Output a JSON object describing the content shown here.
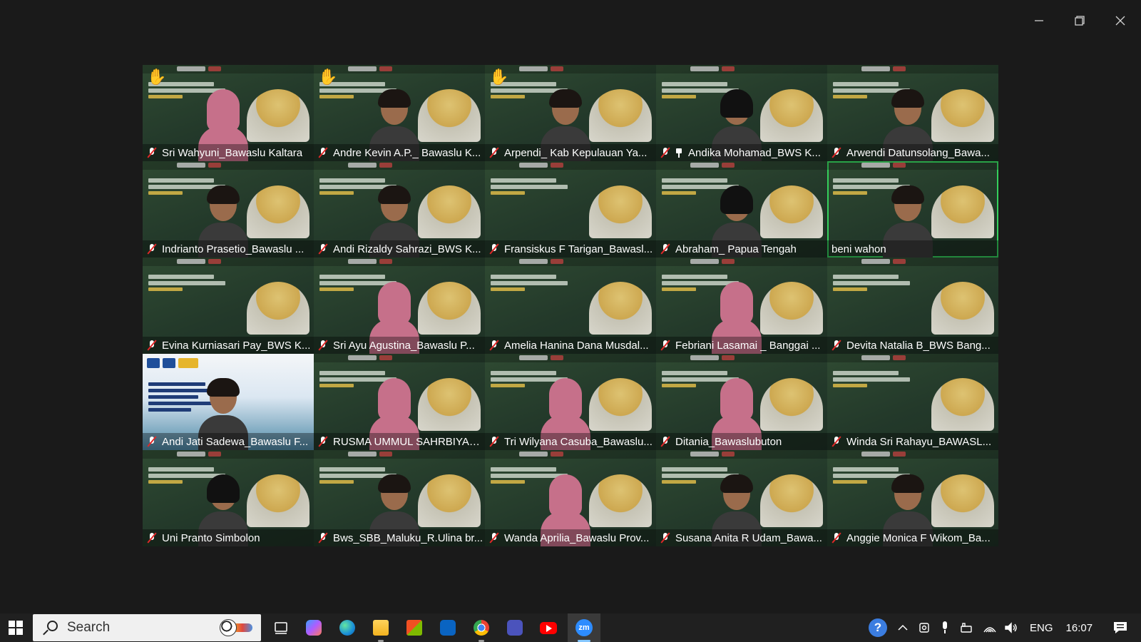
{
  "window": {
    "controls": [
      "minimize",
      "restore",
      "close"
    ]
  },
  "participants": [
    {
      "name": "Sri Wahyuni_Bawaslu Kaltara",
      "muted": true,
      "hand_raised": true
    },
    {
      "name": "Andre Kevin A.P._ Bawaslu K...",
      "muted": true,
      "hand_raised": true
    },
    {
      "name": "Arpendi_ Kab Kepulauan Ya...",
      "muted": true,
      "hand_raised": true
    },
    {
      "name": "Andika Mohamad_BWS K...",
      "muted": true,
      "pinned": true
    },
    {
      "name": "Arwendi Datunsolang_Bawa...",
      "muted": true
    },
    {
      "name": "Indrianto Prasetio_Bawaslu ...",
      "muted": true
    },
    {
      "name": "Andi Rizaldy Sahrazi_BWS K...",
      "muted": true
    },
    {
      "name": "Fransiskus F Tarigan_Bawasl...",
      "muted": true
    },
    {
      "name": "Abraham_ Papua Tengah",
      "muted": true
    },
    {
      "name": "beni wahon",
      "muted": false,
      "active_speaker": true
    },
    {
      "name": "Evina Kurniasari Pay_BWS K...",
      "muted": true
    },
    {
      "name": "Sri Ayu Agustina_Bawaslu P...",
      "muted": true
    },
    {
      "name": "Amelia Hanina Dana Musdal...",
      "muted": true
    },
    {
      "name": "Febriani Lasamai _ Banggai ...",
      "muted": true
    },
    {
      "name": "Devita Natalia B_BWS Bang...",
      "muted": true
    },
    {
      "name": "Andi Jati Sadewa_Bawaslu F...",
      "muted": true,
      "poster_background": true
    },
    {
      "name": "RUSMA UMMUL SAHRBIYAH...",
      "muted": true
    },
    {
      "name": "Tri Wilyana Casuba_Bawaslu...",
      "muted": true
    },
    {
      "name": "Ditania_Bawaslubuton",
      "muted": true
    },
    {
      "name": "Winda Sri Rahayu_BAWASL...",
      "muted": true
    },
    {
      "name": "Uni Pranto Simbolon",
      "muted": true
    },
    {
      "name": "Bws_SBB_Maluku_R.Ulina br...",
      "muted": true
    },
    {
      "name": "Wanda Aprilia_Bawaslu Prov...",
      "muted": true
    },
    {
      "name": "Susana Anita R Udam_Bawa...",
      "muted": true
    },
    {
      "name": "Anggie Monica F Wikom_Ba...",
      "muted": true
    }
  ],
  "taskbar": {
    "search_placeholder": "Search",
    "language": "ENG",
    "time": "16:07",
    "apps": [
      "task-view",
      "copilot",
      "edge",
      "file-explorer",
      "microsoft-store",
      "outlook",
      "chrome",
      "teams",
      "youtube",
      "zoom"
    ],
    "active_app": "zoom",
    "zoom_label": "zm"
  },
  "colors": {
    "active_speaker_border": "#35d05c",
    "taskbar_bg": "#202020",
    "mute_slash": "#e02828"
  }
}
